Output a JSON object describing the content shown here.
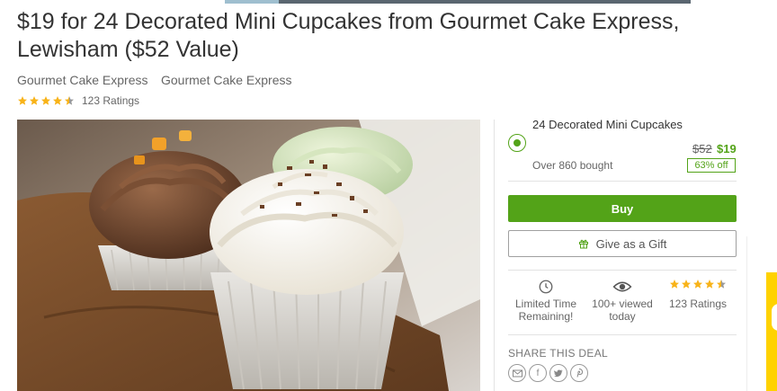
{
  "deal": {
    "title": "$19 for 24 Decorated Mini Cupcakes from Gourmet Cake Express, Lewisham ($52 Value)",
    "merchant_primary": "Gourmet Cake Express",
    "merchant_secondary": "Gourmet Cake Express",
    "rating_stars": 4.5,
    "rating_count": "123 Ratings"
  },
  "image": {
    "alt": "Decorated mini cupcakes photo"
  },
  "option": {
    "title": "24 Decorated Mini Cupcakes",
    "original_price": "$52",
    "price": "$19",
    "bought": "Over 860 bought",
    "discount": "63% off",
    "selected": true
  },
  "actions": {
    "buy_label": "Buy",
    "gift_label": "Give as a Gift"
  },
  "stats": [
    {
      "icon": "clock-icon",
      "text": "Limited Time Remaining!"
    },
    {
      "icon": "eye-icon",
      "text": "100+ viewed today"
    },
    {
      "icon": "stars-icon",
      "text": "123 Ratings"
    }
  ],
  "share": {
    "label": "SHARE THIS DEAL",
    "icons": [
      "email-icon",
      "facebook-icon",
      "twitter-icon",
      "pinterest-icon"
    ]
  },
  "colors": {
    "accent": "#53a318",
    "star": "#f8b319"
  }
}
